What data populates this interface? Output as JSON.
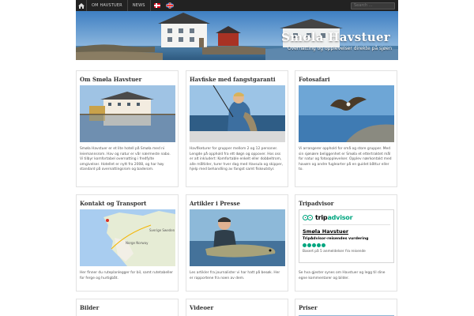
{
  "nav": {
    "items": [
      "OM HAVSTUER",
      "NEWS"
    ],
    "search_placeholder": "Search ..."
  },
  "banner": {
    "title": "Smøla Havstuer",
    "subtitle": "Overnatting og opplevelser direkte på sjøen"
  },
  "cards": [
    {
      "title": "Om Smøla Havstuer",
      "text": "Smøla Havstuer er et lite hotell på Smøla med ni leiemannsrom. Hav og natur er vår nærmeste nabo. Vi tilbyr komfortabel overnatting i fredfylte omgivelser. Hotellet er nytt fra 2008, og har høy standard på overnattingsrom og baderom."
    },
    {
      "title": "Havfiske med fangstgaranti",
      "text": "Havfiketurer for grupper mellom 2 og 12 personer. Lengde på opphold fra ett døgn og oppover. Hos oss er alt inkludert: Komfortable enkelt eller dobbeltrom, alle måltider, turer hver dag med Havsula og skipper, hjelp med behandling av fangst samt fiskeutstyr."
    },
    {
      "title": "Fotosafari",
      "text": "Vi arrangerer opphold for små og store grupper. Med sin sjønære beliggenhet er Smøla et ettertraktet mål for natur og fotoopplevelser. Opplev nærkontakt med havørn og andre fuglearter på en guidet båttur eller to."
    },
    {
      "title": "Kontakt og Transport",
      "text": "Her finner du ruteplanlegger for bil, samt rutetabeller for ferge og hurtigbåt."
    },
    {
      "title": "Artikler i Presse",
      "text": "Les artikler fra journalister vi har hatt på besøk. Her er rapportene fra noen av dem."
    },
    {
      "title": "Tripadvisor",
      "text": "Se hva gjester synes om Havstuer og legg til dine egne kommentarer og bilder."
    },
    {
      "title": "Bilder"
    },
    {
      "title": "Videoer"
    },
    {
      "title": "Priser"
    }
  ],
  "tripadvisor": {
    "brand_trip": "trip",
    "brand_advisor": "advisor",
    "name": "Smøla Havstuer",
    "rating_title": "TripAdvisor-reisendes vurdering",
    "rating": 5,
    "rating_max": 5,
    "count_text": "Basert på 5 anmeldelser fra reisende"
  },
  "map": {
    "labels": [
      "Sverige Sweden",
      "Norge Norway"
    ]
  },
  "colors": {
    "topbar": "#222222",
    "tripadvisor_green": "#00a680"
  }
}
